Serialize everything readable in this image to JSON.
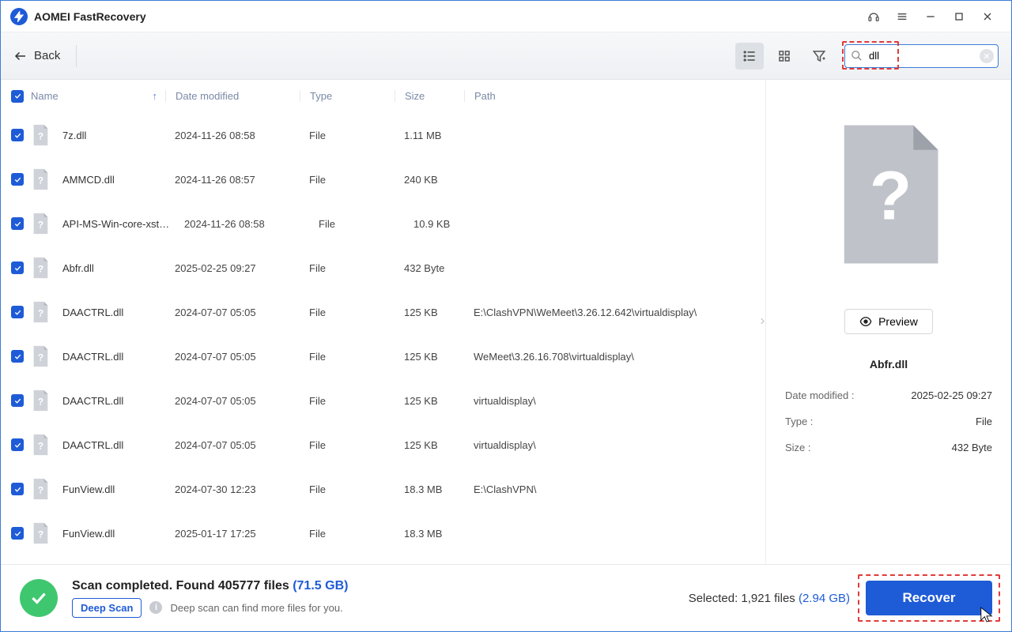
{
  "app_title": "AOMEI FastRecovery",
  "toolbar": {
    "back": "Back",
    "search_value": "dll"
  },
  "columns": {
    "name": "Name",
    "date": "Date modified",
    "type": "Type",
    "size": "Size",
    "path": "Path"
  },
  "files": [
    {
      "name": "7z.dll",
      "date": "2024-11-26 08:58",
      "type": "File",
      "size": "1.11 MB",
      "path": ""
    },
    {
      "name": "AMMCD.dll",
      "date": "2024-11-26 08:57",
      "type": "File",
      "size": "240 KB",
      "path": ""
    },
    {
      "name": "API-MS-Win-core-xstate-...",
      "date": "2024-11-26 08:58",
      "type": "File",
      "size": "10.9 KB",
      "path": ""
    },
    {
      "name": "Abfr.dll",
      "date": "2025-02-25 09:27",
      "type": "File",
      "size": "432 Byte",
      "path": ""
    },
    {
      "name": "DAACTRL.dll",
      "date": "2024-07-07 05:05",
      "type": "File",
      "size": "125 KB",
      "path": "E:\\ClashVPN\\WeMeet\\3.26.12.642\\virtualdisplay\\"
    },
    {
      "name": "DAACTRL.dll",
      "date": "2024-07-07 05:05",
      "type": "File",
      "size": "125 KB",
      "path": "WeMeet\\3.26.16.708\\virtualdisplay\\"
    },
    {
      "name": "DAACTRL.dll",
      "date": "2024-07-07 05:05",
      "type": "File",
      "size": "125 KB",
      "path": "virtualdisplay\\"
    },
    {
      "name": "DAACTRL.dll",
      "date": "2024-07-07 05:05",
      "type": "File",
      "size": "125 KB",
      "path": "virtualdisplay\\"
    },
    {
      "name": "FunView.dll",
      "date": "2024-07-30 12:23",
      "type": "File",
      "size": "18.3 MB",
      "path": "E:\\ClashVPN\\"
    },
    {
      "name": "FunView.dll",
      "date": "2025-01-17 17:25",
      "type": "File",
      "size": "18.3 MB",
      "path": ""
    }
  ],
  "preview": {
    "button": "Preview",
    "filename": "Abfr.dll",
    "meta": {
      "date_label": "Date modified :",
      "date_value": "2025-02-25 09:27",
      "type_label": "Type :",
      "type_value": "File",
      "size_label": "Size :",
      "size_value": "432 Byte"
    }
  },
  "footer": {
    "status_prefix": "Scan completed. Found 405777 files ",
    "status_size": "(71.5 GB)",
    "deep_scan": "Deep Scan",
    "deep_hint": "Deep scan can find more files for you.",
    "selected_prefix": "Selected: 1,921 files ",
    "selected_size": "(2.94 GB)",
    "recover": "Recover"
  }
}
